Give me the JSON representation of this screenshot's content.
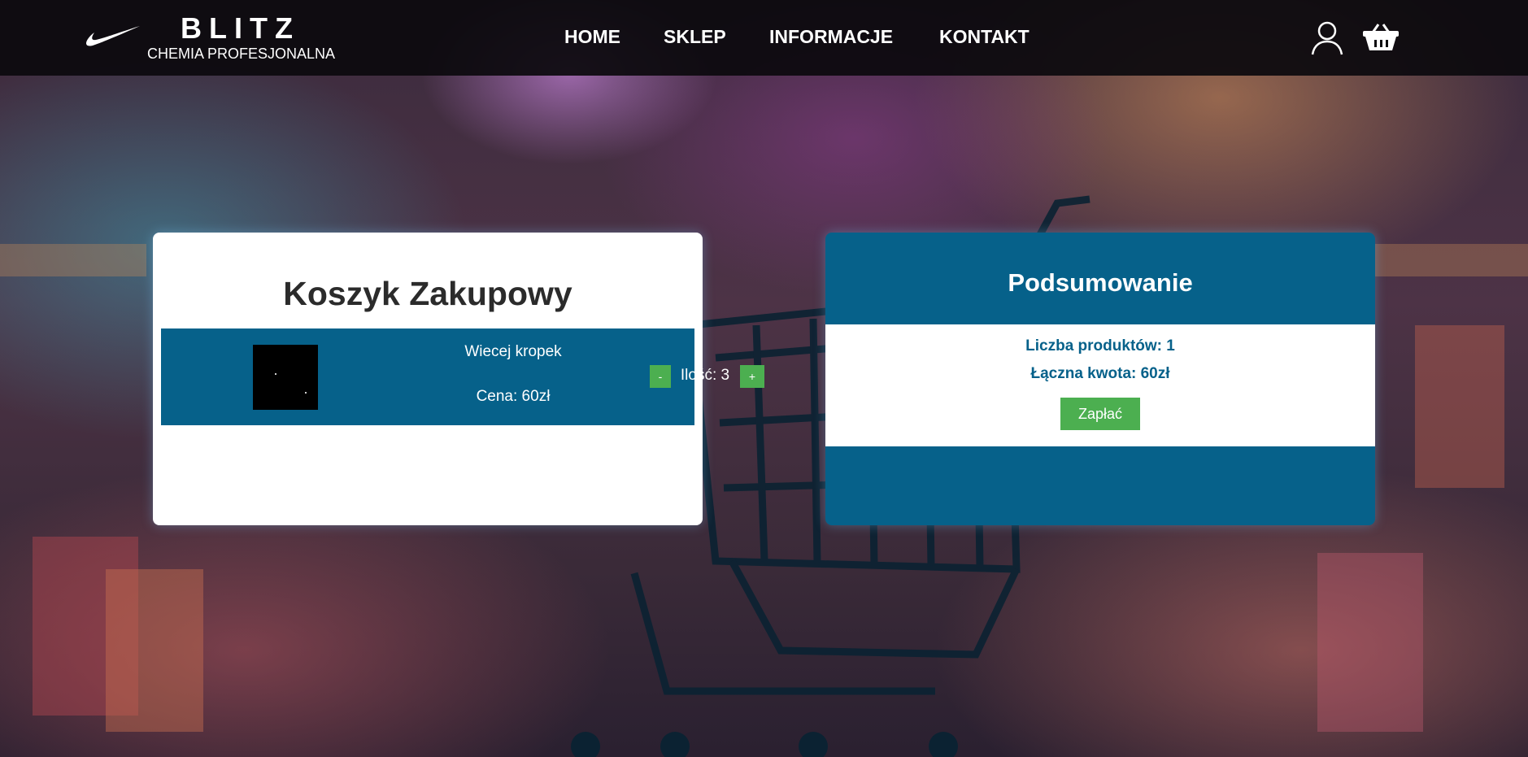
{
  "header": {
    "brand_name": "BLITZ",
    "brand_subtitle": "CHEMIA PROFESJONALNA",
    "logo_icon": "swoosh-icon",
    "nav": [
      {
        "label": "HOME"
      },
      {
        "label": "SKLEP"
      },
      {
        "label": "INFORMACJE"
      },
      {
        "label": "KONTAKT"
      }
    ],
    "icons": {
      "account": "user-icon",
      "cart": "basket-icon"
    }
  },
  "cart": {
    "title": "Koszyk Zakupowy",
    "items": [
      {
        "name": "Wiecej kropek",
        "decrement_label": "-",
        "quantity_text": "Ilość: 3",
        "increment_label": "+",
        "price_text": "Cena: 60zł"
      }
    ]
  },
  "summary": {
    "title": "Podsumowanie",
    "products_count_text": "Liczba produktów: 1",
    "total_text": "Łączna kwota: 60zł",
    "pay_label": "Zapłać"
  },
  "colors": {
    "header_bg": "#0c0a0e",
    "panel_blue": "#06618a",
    "button_green": "#4caf50",
    "panel_white": "#ffffff"
  }
}
